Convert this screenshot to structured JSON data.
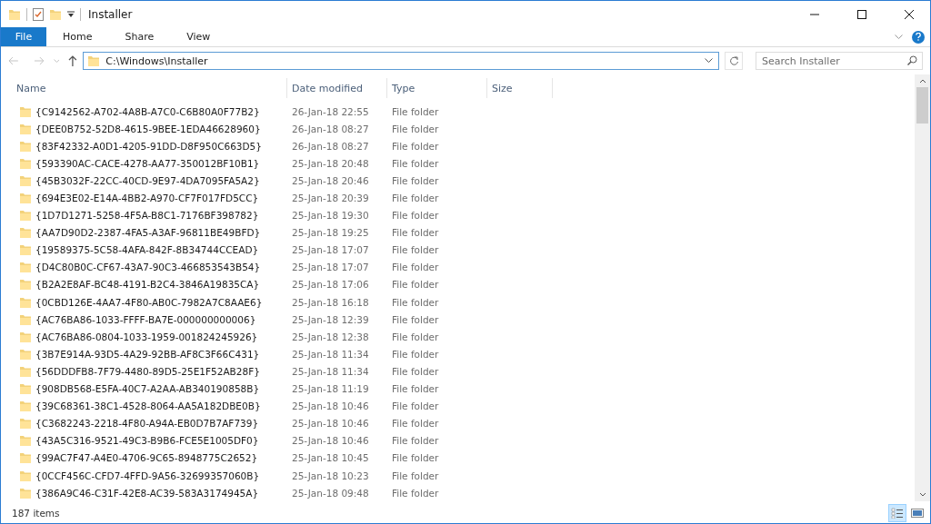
{
  "window": {
    "title": "Installer"
  },
  "ribbon_tabs": [
    {
      "label": "File",
      "selected": true
    },
    {
      "label": "Home",
      "selected": false
    },
    {
      "label": "Share",
      "selected": false
    },
    {
      "label": "View",
      "selected": false
    }
  ],
  "address": {
    "value": "C:\\Windows\\Installer"
  },
  "search": {
    "placeholder": "Search Installer"
  },
  "columns": [
    "Name",
    "Date modified",
    "Type",
    "Size"
  ],
  "rows": [
    {
      "name": "{C9142562-A702-4A8B-A7C0-C6B80A0F77B2}",
      "date": "26-Jan-18 22:55",
      "type": "File folder"
    },
    {
      "name": "{DEE0B752-52D8-4615-9BEE-1EDA46628960}",
      "date": "26-Jan-18 08:27",
      "type": "File folder"
    },
    {
      "name": "{83F42332-A0D1-4205-91DD-D8F950C663D5}",
      "date": "26-Jan-18 08:27",
      "type": "File folder"
    },
    {
      "name": "{593390AC-CACE-4278-AA77-350012BF10B1}",
      "date": "25-Jan-18 20:48",
      "type": "File folder"
    },
    {
      "name": "{45B3032F-22CC-40CD-9E97-4DA7095FA5A2}",
      "date": "25-Jan-18 20:46",
      "type": "File folder"
    },
    {
      "name": "{694E3E02-E14A-4BB2-A970-CF7F017FD5CC}",
      "date": "25-Jan-18 20:39",
      "type": "File folder"
    },
    {
      "name": "{1D7D1271-5258-4F5A-B8C1-7176BF398782}",
      "date": "25-Jan-18 19:30",
      "type": "File folder"
    },
    {
      "name": "{AA7D90D2-2387-4FA5-A3AF-96811BE49BFD}",
      "date": "25-Jan-18 19:25",
      "type": "File folder"
    },
    {
      "name": "{19589375-5C58-4AFA-842F-8B34744CCEAD}",
      "date": "25-Jan-18 17:07",
      "type": "File folder"
    },
    {
      "name": "{D4C80B0C-CF67-43A7-90C3-466853543B54}",
      "date": "25-Jan-18 17:07",
      "type": "File folder"
    },
    {
      "name": "{B2A2E8AF-BC48-4191-B2C4-3846A19835CA}",
      "date": "25-Jan-18 17:06",
      "type": "File folder"
    },
    {
      "name": "{0CBD126E-4AA7-4F80-AB0C-7982A7C8AAE6}",
      "date": "25-Jan-18 16:18",
      "type": "File folder"
    },
    {
      "name": "{AC76BA86-1033-FFFF-BA7E-000000000006}",
      "date": "25-Jan-18 12:39",
      "type": "File folder"
    },
    {
      "name": "{AC76BA86-0804-1033-1959-001824245926}",
      "date": "25-Jan-18 12:38",
      "type": "File folder"
    },
    {
      "name": "{3B7E914A-93D5-4A29-92BB-AF8C3F66C431}",
      "date": "25-Jan-18 11:34",
      "type": "File folder"
    },
    {
      "name": "{56DDDFB8-7F79-4480-89D5-25E1F52AB28F}",
      "date": "25-Jan-18 11:34",
      "type": "File folder"
    },
    {
      "name": "{908DB568-E5FA-40C7-A2AA-AB340190858B}",
      "date": "25-Jan-18 11:19",
      "type": "File folder"
    },
    {
      "name": "{39C68361-38C1-4528-8064-AA5A182DBE0B}",
      "date": "25-Jan-18 10:46",
      "type": "File folder"
    },
    {
      "name": "{C3682243-2218-4F80-A94A-EB0D7B7AF739}",
      "date": "25-Jan-18 10:46",
      "type": "File folder"
    },
    {
      "name": "{43A5C316-9521-49C3-B9B6-FCE5E1005DF0}",
      "date": "25-Jan-18 10:46",
      "type": "File folder"
    },
    {
      "name": "{99AC7F47-A4E0-4706-9C65-8948775C2652}",
      "date": "25-Jan-18 10:45",
      "type": "File folder"
    },
    {
      "name": "{0CCF456C-CFD7-4FFD-9A56-32699357060B}",
      "date": "25-Jan-18 10:23",
      "type": "File folder"
    },
    {
      "name": "{386A9C46-C31F-42E8-AC39-583A3174945A}",
      "date": "25-Jan-18 09:48",
      "type": "File folder"
    }
  ],
  "status_bar": {
    "count": "187 items"
  },
  "view_buttons": [
    {
      "kind": "details",
      "selected": true
    },
    {
      "kind": "large",
      "selected": false
    }
  ]
}
